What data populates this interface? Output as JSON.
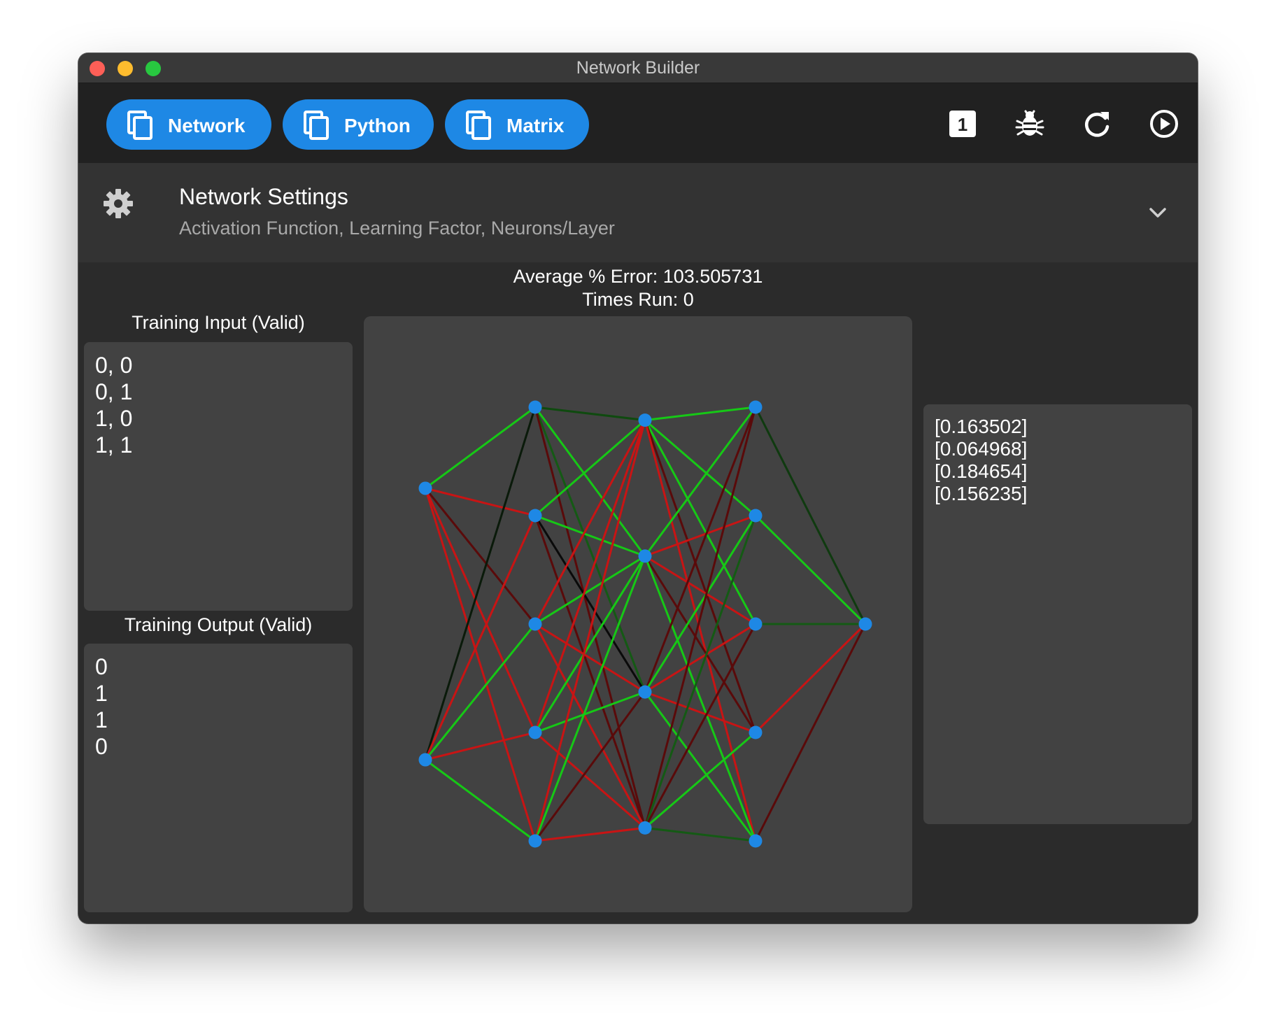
{
  "window": {
    "title": "Network Builder"
  },
  "toolbar": {
    "tabs": [
      {
        "label": "Network",
        "icon": "copy-icon"
      },
      {
        "label": "Python",
        "icon": "copy-icon"
      },
      {
        "label": "Matrix",
        "icon": "copy-icon"
      }
    ],
    "step_badge": "1",
    "actions": [
      "step-one-icon",
      "bug-icon",
      "refresh-icon",
      "play-circle-icon"
    ]
  },
  "settings": {
    "title": "Network Settings",
    "subtitle": "Activation Function, Learning Factor, Neurons/Layer"
  },
  "stats": {
    "error_line": "Average % Error: 103.505731",
    "runs_line": "Times Run: 0"
  },
  "training_input": {
    "label": "Training Input (Valid)",
    "lines": [
      "0, 0",
      "0, 1",
      "1, 0",
      "1, 1"
    ]
  },
  "training_output": {
    "label": "Training Output (Valid)",
    "lines": [
      "0",
      "1",
      "1",
      "0"
    ]
  },
  "predictions": {
    "lines": [
      "[0.163502]",
      "[0.064968]",
      "[0.184654]",
      "[0.156235]"
    ]
  },
  "colors": {
    "accent": "#1e88e5",
    "node": "#1e88e5",
    "edge_green": "#16c816",
    "edge_red": "#c81414",
    "edge_dark_green": "#145a14",
    "edge_dark_red": "#5a0a0a"
  },
  "network": {
    "layers": [
      2,
      5,
      4,
      5,
      1
    ],
    "edge_colors": [
      [
        [
          "#16c816",
          "#c81414",
          "#5a0a0a",
          "#c81414",
          "#c81414"
        ],
        [
          "#0a1a0a",
          "#c81414",
          "#16c816",
          "#c81414",
          "#16c816"
        ]
      ],
      [
        [
          "#0f4a0f",
          "#16c816",
          "#145a14",
          "#5a0a0a"
        ],
        [
          "#16c816",
          "#16c816",
          "#0a0a0a",
          "#5a0a0a"
        ],
        [
          "#c81414",
          "#16c816",
          "#c81414",
          "#c81414"
        ],
        [
          "#c81414",
          "#16c816",
          "#16c816",
          "#c81414"
        ],
        [
          "#c81414",
          "#16c816",
          "#5a0a0a",
          "#c81414"
        ]
      ],
      [
        [
          "#16c816",
          "#16c816",
          "#16c816",
          "#5a0a0a",
          "#c81414"
        ],
        [
          "#16c816",
          "#c81414",
          "#c81414",
          "#5a0a0a",
          "#16c816"
        ],
        [
          "#5a0a0a",
          "#16c816",
          "#c81414",
          "#c81414",
          "#16c816"
        ],
        [
          "#5a0a0a",
          "#145a14",
          "#5a0a0a",
          "#16c816",
          "#145a14"
        ]
      ],
      [
        [
          "#0f3a0f"
        ],
        [
          "#16c816"
        ],
        [
          "#145a14"
        ],
        [
          "#c81414"
        ],
        [
          "#5a0a0a"
        ]
      ]
    ]
  }
}
